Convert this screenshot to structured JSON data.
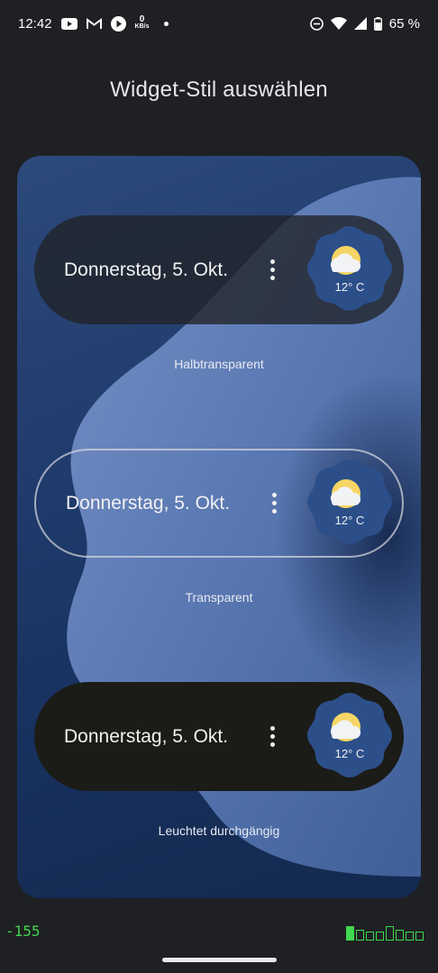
{
  "status_bar": {
    "time": "12:42",
    "net_speed_value": "0",
    "net_speed_unit": "KB/s",
    "battery": "65 %",
    "icons": [
      "youtube-icon",
      "gmail-icon",
      "play-icon",
      "dnd-icon",
      "wifi-icon",
      "signal-icon",
      "battery-icon"
    ]
  },
  "page": {
    "title": "Widget-Stil auswählen"
  },
  "widgets": [
    {
      "date": "Donnerstag, 5. Okt.",
      "temp": "12° C",
      "label": "Halbtransparent"
    },
    {
      "date": "Donnerstag, 5. Okt.",
      "temp": "12° C",
      "label": "Transparent"
    },
    {
      "date": "Donnerstag, 5. Okt.",
      "temp": "12° C",
      "label": "Leuchtet durchgängig"
    }
  ],
  "debug": {
    "value": "-155"
  },
  "colors": {
    "background": "#1f2023",
    "wallpaper_dark": "#1f3a6b",
    "wallpaper_light": "#6a86bd",
    "weather_bubble": "#2c4f8a",
    "sun": "#f5d565",
    "debug_green": "#40d850"
  }
}
